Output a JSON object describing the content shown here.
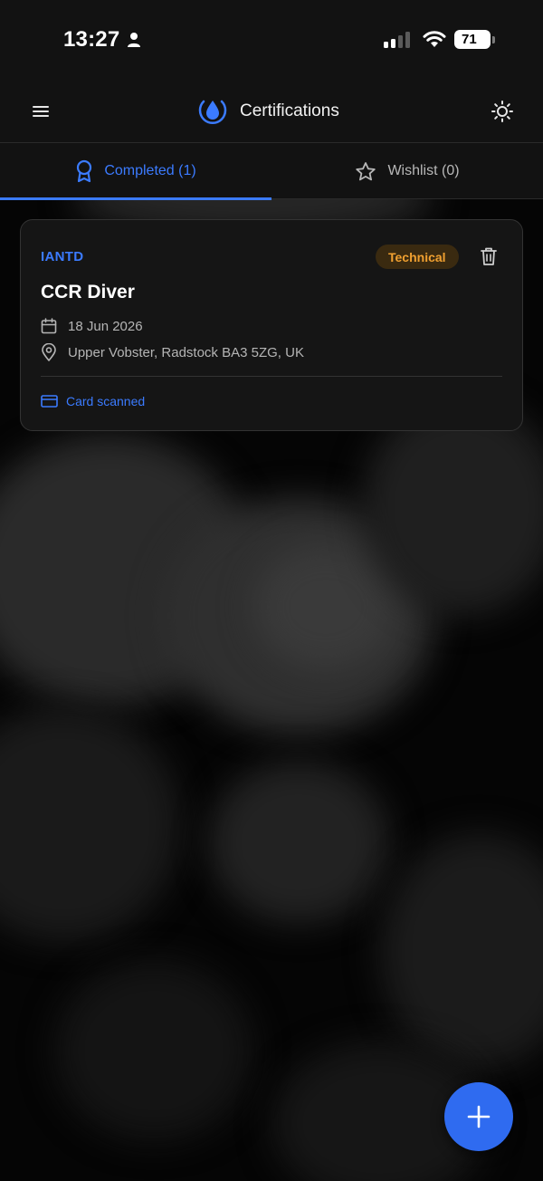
{
  "status_bar": {
    "time": "13:27",
    "battery_level": "71",
    "icons": [
      "person-icon",
      "cellular-signal-icon",
      "wifi-icon",
      "battery-icon"
    ]
  },
  "app_bar": {
    "title": "Certifications",
    "icons": [
      "hamburger-menu-icon",
      "water-drop-logo-icon",
      "theme-toggle-sun-icon"
    ],
    "accent_color": "#3b7bff"
  },
  "tabs": [
    {
      "label": "Completed (1)",
      "icon": "award-ribbon-icon",
      "active": true
    },
    {
      "label": "Wishlist (0)",
      "icon": "star-icon",
      "active": false
    }
  ],
  "certifications": [
    {
      "organization": "IANTD",
      "category": "Technical",
      "name": "CCR Diver",
      "date": "18 Jun 2026",
      "location": "Upper Vobster, Radstock BA3 5ZG, UK",
      "card_status": "Card scanned",
      "badge_color": "#f0a030"
    }
  ],
  "fab": {
    "icon": "plus-icon"
  }
}
